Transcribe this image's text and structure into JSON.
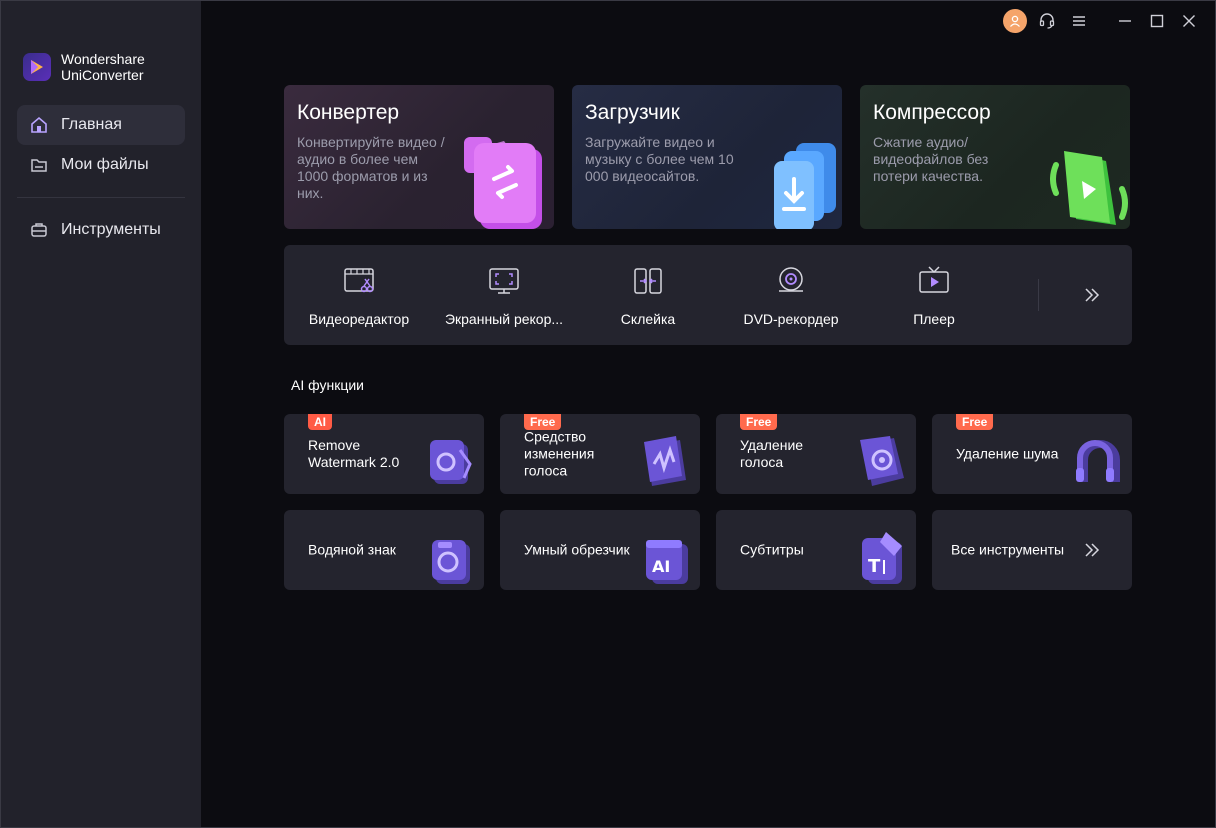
{
  "brand": {
    "line1": "Wondershare",
    "line2": "UniConverter"
  },
  "sidebar": {
    "items": [
      {
        "label": "Главная",
        "icon": "home-icon",
        "active": true
      },
      {
        "label": "Мои файлы",
        "icon": "folder-icon",
        "active": false
      },
      {
        "label": "Инструменты",
        "icon": "toolbox-icon",
        "active": false
      }
    ]
  },
  "features": [
    {
      "title": "Конвертер",
      "desc": "Конвертируйте видео / аудио в более чем 1000 форматов и из них.",
      "icon": "convert-icon"
    },
    {
      "title": "Загрузчик",
      "desc": "Загружайте видео и музыку с более чем 10 000 видеосайтов.",
      "icon": "download-icon"
    },
    {
      "title": "Компрессор",
      "desc": "Сжатие аудио/ видеофайлов без потери качества.",
      "icon": "compress-icon"
    }
  ],
  "tools": [
    {
      "label": "Видеоредактор",
      "icon": "video-editor-icon"
    },
    {
      "label": "Экранный рекор...",
      "icon": "screen-recorder-icon"
    },
    {
      "label": "Склейка",
      "icon": "merger-icon"
    },
    {
      "label": "DVD-рекордер",
      "icon": "dvd-burner-icon"
    },
    {
      "label": "Плеер",
      "icon": "player-icon"
    }
  ],
  "ai_section": {
    "title": "AI функции"
  },
  "ai_cards": [
    {
      "label": "Remove Watermark 2.0",
      "badge": "AI"
    },
    {
      "label": "Средство изменения голоса",
      "badge": "Free"
    },
    {
      "label": "Удаление голоса",
      "badge": "Free"
    },
    {
      "label": "Удаление шума",
      "badge": "Free"
    },
    {
      "label": "Водяной знак",
      "badge": ""
    },
    {
      "label": "Умный обрезчик",
      "badge": ""
    },
    {
      "label": "Субтитры",
      "badge": ""
    },
    {
      "label": "Все инструменты",
      "badge": ""
    }
  ],
  "colors": {
    "accent_purple": "#8b5cf6",
    "badge_red": "#ff5b45",
    "avatar": "#f5a46a"
  }
}
